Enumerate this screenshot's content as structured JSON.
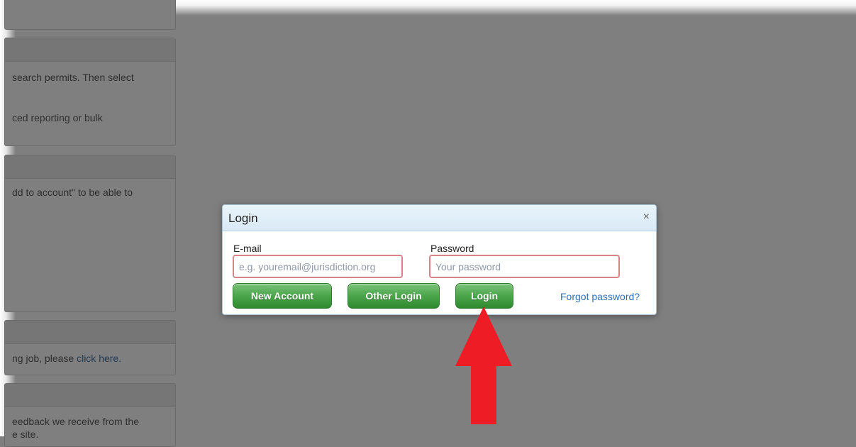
{
  "side_panels": [
    {
      "lines": []
    },
    {
      "lines": [
        "search permits. Then select",
        "ced reporting or bulk"
      ]
    },
    {
      "lines": [
        "dd to account\" to be able to"
      ]
    },
    {
      "line_prefix": "ng job, please ",
      "link_text": "click here."
    },
    {
      "lines": [
        "eedback we receive from the",
        "e site."
      ]
    }
  ],
  "modal": {
    "title": "Login",
    "close_glyph": "×",
    "email": {
      "label": "E-mail",
      "placeholder": "e.g. youremail@jurisdiction.org",
      "value": ""
    },
    "password": {
      "label": "Password",
      "placeholder": "Your password",
      "value": ""
    },
    "buttons": {
      "new_account": "New Account",
      "other_login": "Other Login",
      "login": "Login"
    },
    "forgot_link": "Forgot password?"
  },
  "annotation": {
    "icon": "red-up-arrow-icon",
    "color": "#ee1c24"
  },
  "colors": {
    "overlay": "#7f7f7f",
    "button_green": "#4ea84e",
    "link_blue": "#2f6fb5",
    "input_error_border": "#d9828a"
  }
}
